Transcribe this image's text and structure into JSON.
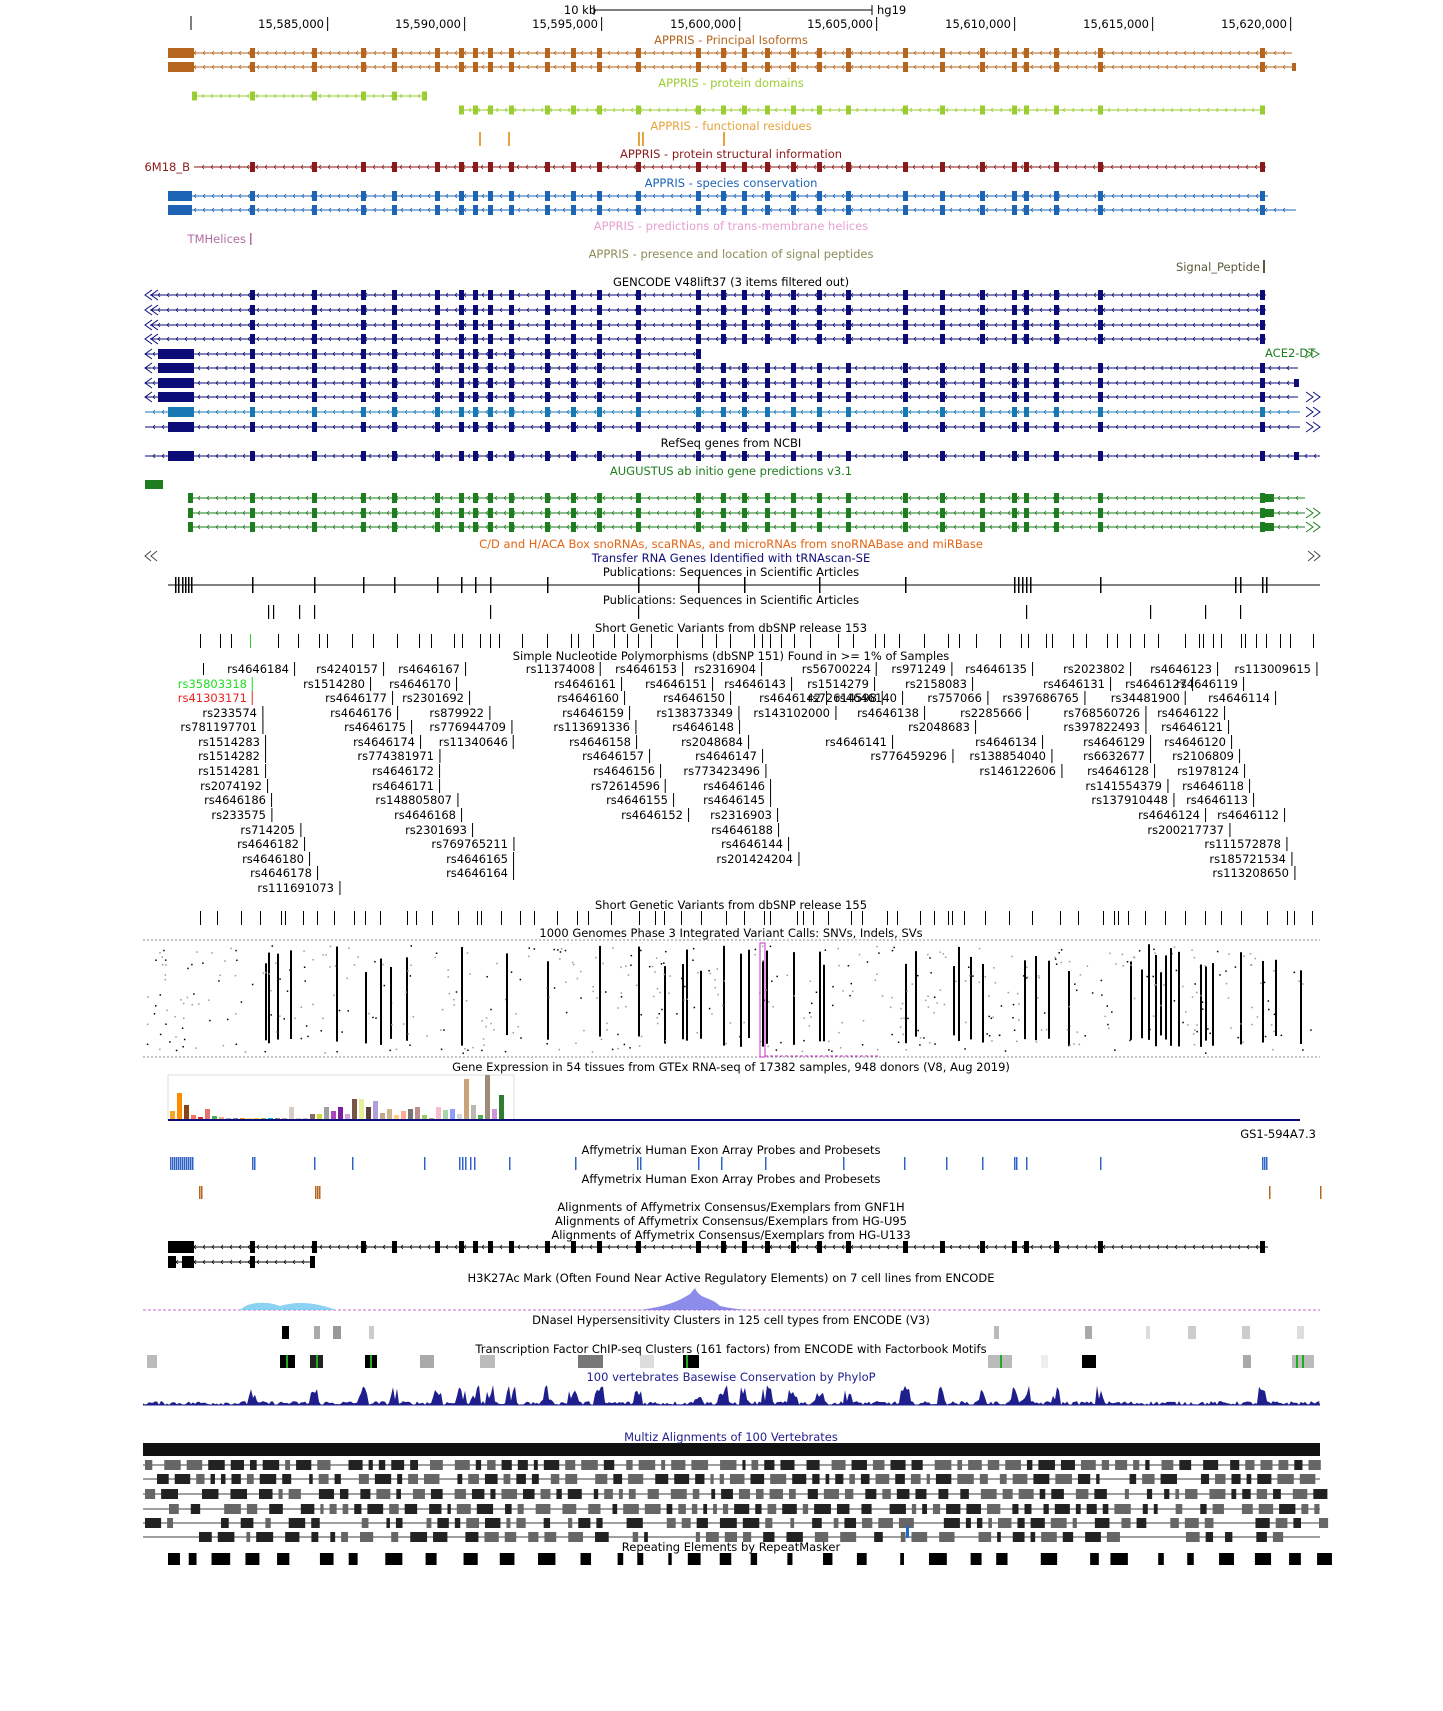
{
  "ruler": {
    "scale_label": "10 kb",
    "assembly": "hg19",
    "ticks": [
      "15,585,000",
      "15,590,000",
      "15,595,000",
      "15,600,000",
      "15,605,000",
      "15,610,000",
      "15,615,000",
      "15,620,000"
    ]
  },
  "tracks": {
    "appris_principal": {
      "title": "APPRIS - Principal Isoforms",
      "color": "#b5651d"
    },
    "appris_domains": {
      "title": "APPRIS - protein domains",
      "color": "#9acd32"
    },
    "appris_functional": {
      "title": "APPRIS - functional residues",
      "color": "#e6a23c"
    },
    "appris_structural": {
      "title": "APPRIS - protein structural information",
      "color": "#8b1a1a",
      "item_label": "6M18_B"
    },
    "appris_conservation": {
      "title": "APPRIS - species conservation",
      "color": "#1e64b4"
    },
    "appris_tm": {
      "title": "APPRIS - predictions of trans-membrane helices",
      "color": "#e6a0d2",
      "item_label": "TMHelices"
    },
    "appris_signal": {
      "title": "APPRIS - presence and location of signal peptides",
      "color": "#8c8c5a",
      "item_label": "Signal_Peptide"
    },
    "gencode": {
      "title": "GENCODE V48lift37 (3 items filtered out)",
      "color": "#0c0c78",
      "item_label": "ACE2-DT"
    },
    "refseq": {
      "title": "RefSeq genes from NCBI",
      "color": "#0c0c78"
    },
    "augustus": {
      "title": "AUGUSTUS ab initio gene predictions v3.1",
      "color": "#1e7d1e"
    },
    "snorna": {
      "title": "C/D and H/ACA Box snoRNAs, scaRNAs, and microRNAs from snoRNABase and miRBase",
      "color": "#e36414"
    },
    "trna": {
      "title": "Transfer RNA Genes Identified with tRNAscan-SE",
      "color": "#0c0c78"
    },
    "pubs1": {
      "title": "Publications: Sequences in Scientific Articles"
    },
    "pubs2": {
      "title": "Publications: Sequences in Scientific Articles"
    },
    "snp153": {
      "title": "Short Genetic Variants from dbSNP release 153"
    },
    "snp151common": {
      "title": "Simple Nucleotide Polymorphisms (dbSNP 151) Found in >= 1% of Samples"
    },
    "snp155": {
      "title": "Short Genetic Variants from dbSNP release 155"
    },
    "kg1000": {
      "title": "1000 Genomes Phase 3 Integrated Variant Calls: SNVs, Indels, SVs"
    },
    "gtex": {
      "title": "Gene Expression in 54 tissues from GTEx RNA-seq of 17382 samples, 948 donors (V8, Aug 2019)",
      "item_label": "GS1-594A7.3"
    },
    "affy_exon1": {
      "title": "Affymetrix Human Exon Array Probes and Probesets"
    },
    "affy_exon2": {
      "title": "Affymetrix Human Exon Array Probes and Probesets"
    },
    "affy_gnf": {
      "title": "Alignments of Affymetrix Consensus/Exemplars from GNF1H"
    },
    "affy_u95": {
      "title": "Alignments of Affymetrix Consensus/Exemplars from HG-U95"
    },
    "affy_u133": {
      "title": "Alignments of Affymetrix Consensus/Exemplars from HG-U133"
    },
    "h3k27ac": {
      "title": "H3K27Ac Mark (Often Found Near Active Regulatory Elements) on 7 cell lines from ENCODE"
    },
    "dnase": {
      "title": "DNaseI Hypersensitivity Clusters in 125 cell types from ENCODE (V3)"
    },
    "tfbs": {
      "title": "Transcription Factor ChIP-seq Clusters (161 factors) from ENCODE with Factorbook Motifs"
    },
    "phylop": {
      "title": "100 vertebrates Basewise Conservation by PhyloP",
      "color": "#1e1e8c"
    },
    "multiz": {
      "title": "Multiz Alignments of 100 Vertebrates",
      "color": "#1e1e8c"
    },
    "rmsk": {
      "title": "Repeating Elements by RepeatMasker"
    }
  },
  "snp_labels": [
    {
      "id": "rs4646184"
    },
    {
      "id": "rs35803318",
      "color": "#22dd22"
    },
    {
      "id": "rs41303171",
      "color": "#ee2222"
    },
    {
      "id": "rs233574"
    },
    {
      "id": "rs781197701"
    },
    {
      "id": "rs1514283"
    },
    {
      "id": "rs1514282"
    },
    {
      "id": "rs1514281"
    },
    {
      "id": "rs2074192"
    },
    {
      "id": "rs4646186"
    },
    {
      "id": "rs233575"
    },
    {
      "id": "rs714205"
    },
    {
      "id": "rs4646182"
    },
    {
      "id": "rs4646180"
    },
    {
      "id": "rs4646178"
    },
    {
      "id": "rs111691073"
    },
    {
      "id": "rs4240157"
    },
    {
      "id": "rs1514280"
    },
    {
      "id": "rs4646177"
    },
    {
      "id": "rs4646176"
    },
    {
      "id": "rs4646175"
    },
    {
      "id": "rs4646174"
    },
    {
      "id": "rs774381971"
    },
    {
      "id": "rs4646172"
    },
    {
      "id": "rs4646171"
    },
    {
      "id": "rs148805807"
    },
    {
      "id": "rs4646168"
    },
    {
      "id": "rs2301693"
    },
    {
      "id": "rs769765211"
    },
    {
      "id": "rs4646165"
    },
    {
      "id": "rs4646164"
    },
    {
      "id": "rs4646167"
    },
    {
      "id": "rs4646170"
    },
    {
      "id": "rs2301692"
    },
    {
      "id": "rs879922"
    },
    {
      "id": "rs776944709"
    },
    {
      "id": "rs11340646"
    },
    {
      "id": "rs11374008"
    },
    {
      "id": "rs4646161"
    },
    {
      "id": "rs4646160"
    },
    {
      "id": "rs4646159"
    },
    {
      "id": "rs113691336"
    },
    {
      "id": "rs4646158"
    },
    {
      "id": "rs4646157"
    },
    {
      "id": "rs4646156"
    },
    {
      "id": "rs72614596"
    },
    {
      "id": "rs4646155"
    },
    {
      "id": "rs4646152"
    },
    {
      "id": "rs4646153"
    },
    {
      "id": "rs4646151"
    },
    {
      "id": "rs4646150"
    },
    {
      "id": "rs138373349"
    },
    {
      "id": "rs4646148"
    },
    {
      "id": "rs2048684"
    },
    {
      "id": "rs4646147"
    },
    {
      "id": "rs773423496"
    },
    {
      "id": "rs4646146"
    },
    {
      "id": "rs4646145"
    },
    {
      "id": "rs2316903"
    },
    {
      "id": "rs4646188"
    },
    {
      "id": "rs4646144"
    },
    {
      "id": "rs201424204"
    },
    {
      "id": "rs2316904"
    },
    {
      "id": "rs4646143"
    },
    {
      "id": "rs4646142"
    },
    {
      "id": "rs143102000"
    },
    {
      "id": "rs56700224"
    },
    {
      "id": "rs1514279"
    },
    {
      "id": "rs72614598"
    },
    {
      "id": "rs4646141"
    },
    {
      "id": "rs971249"
    },
    {
      "id": "rs2158083"
    },
    {
      "id": "rs4646140"
    },
    {
      "id": "rs4646138"
    },
    {
      "id": "rs757066"
    },
    {
      "id": "rs2048683"
    },
    {
      "id": "rs776459296"
    },
    {
      "id": "rs4646135"
    },
    {
      "id": "rs397686765"
    },
    {
      "id": "rs2285666"
    },
    {
      "id": "rs4646134"
    },
    {
      "id": "rs138854040"
    },
    {
      "id": "rs146122606"
    },
    {
      "id": "rs2023802"
    },
    {
      "id": "rs4646131"
    },
    {
      "id": "rs768560726"
    },
    {
      "id": "rs397822493"
    },
    {
      "id": "rs4646129"
    },
    {
      "id": "rs6632677"
    },
    {
      "id": "rs4646128"
    },
    {
      "id": "rs141554379"
    },
    {
      "id": "rs137910448"
    },
    {
      "id": "rs4646124"
    },
    {
      "id": "rs200217737"
    },
    {
      "id": "rs4646127"
    },
    {
      "id": "rs34481900"
    },
    {
      "id": "rs4646122"
    },
    {
      "id": "rs4646121"
    },
    {
      "id": "rs4646120"
    },
    {
      "id": "rs2106809"
    },
    {
      "id": "rs1978124"
    },
    {
      "id": "rs4646118"
    },
    {
      "id": "rs4646113"
    },
    {
      "id": "rs4646112"
    },
    {
      "id": "rs111572878"
    },
    {
      "id": "rs185721534"
    },
    {
      "id": "rs113208650"
    },
    {
      "id": "rs4646123"
    },
    {
      "id": "rs4646119"
    },
    {
      "id": "rs4646114"
    },
    {
      "id": "rs113009615"
    }
  ]
}
